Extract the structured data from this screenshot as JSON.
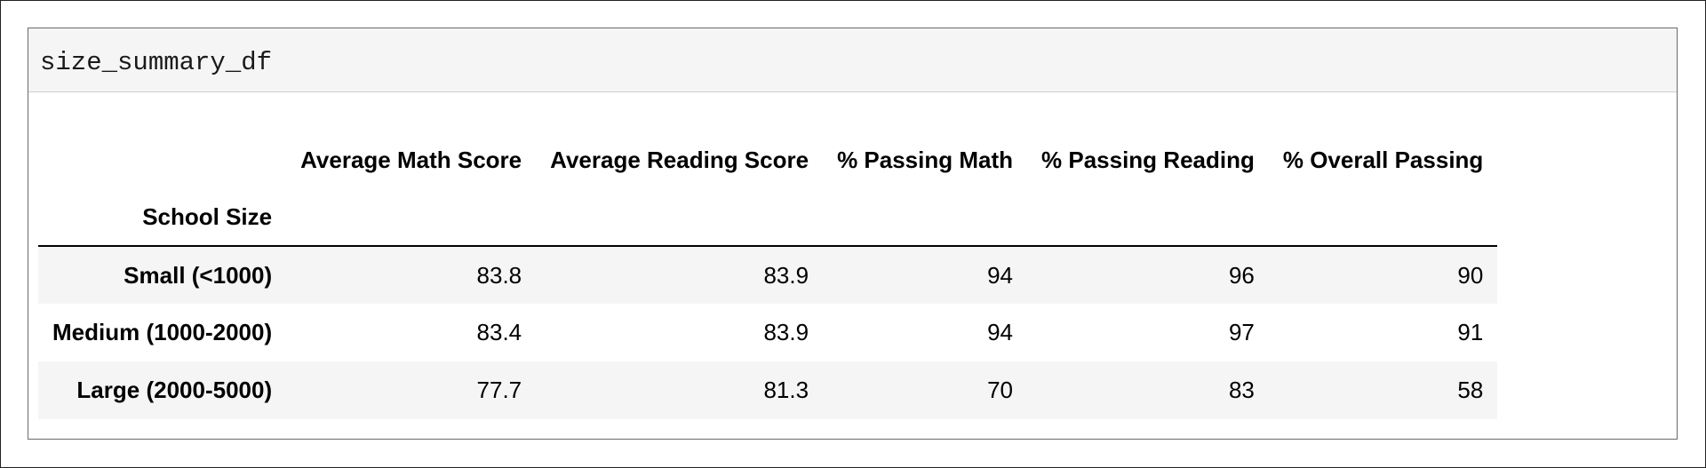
{
  "cell": {
    "code": "size_summary_df"
  },
  "table": {
    "index_name": "School Size",
    "columns": [
      "Average Math Score",
      "Average Reading Score",
      "% Passing Math",
      "% Passing Reading",
      "% Overall Passing"
    ],
    "rows": [
      {
        "index": "Small (<1000)",
        "values": [
          "83.8",
          "83.9",
          "94",
          "96",
          "90"
        ]
      },
      {
        "index": "Medium (1000-2000)",
        "values": [
          "83.4",
          "83.9",
          "94",
          "97",
          "91"
        ]
      },
      {
        "index": "Large (2000-5000)",
        "values": [
          "77.7",
          "81.3",
          "70",
          "83",
          "58"
        ]
      }
    ]
  }
}
